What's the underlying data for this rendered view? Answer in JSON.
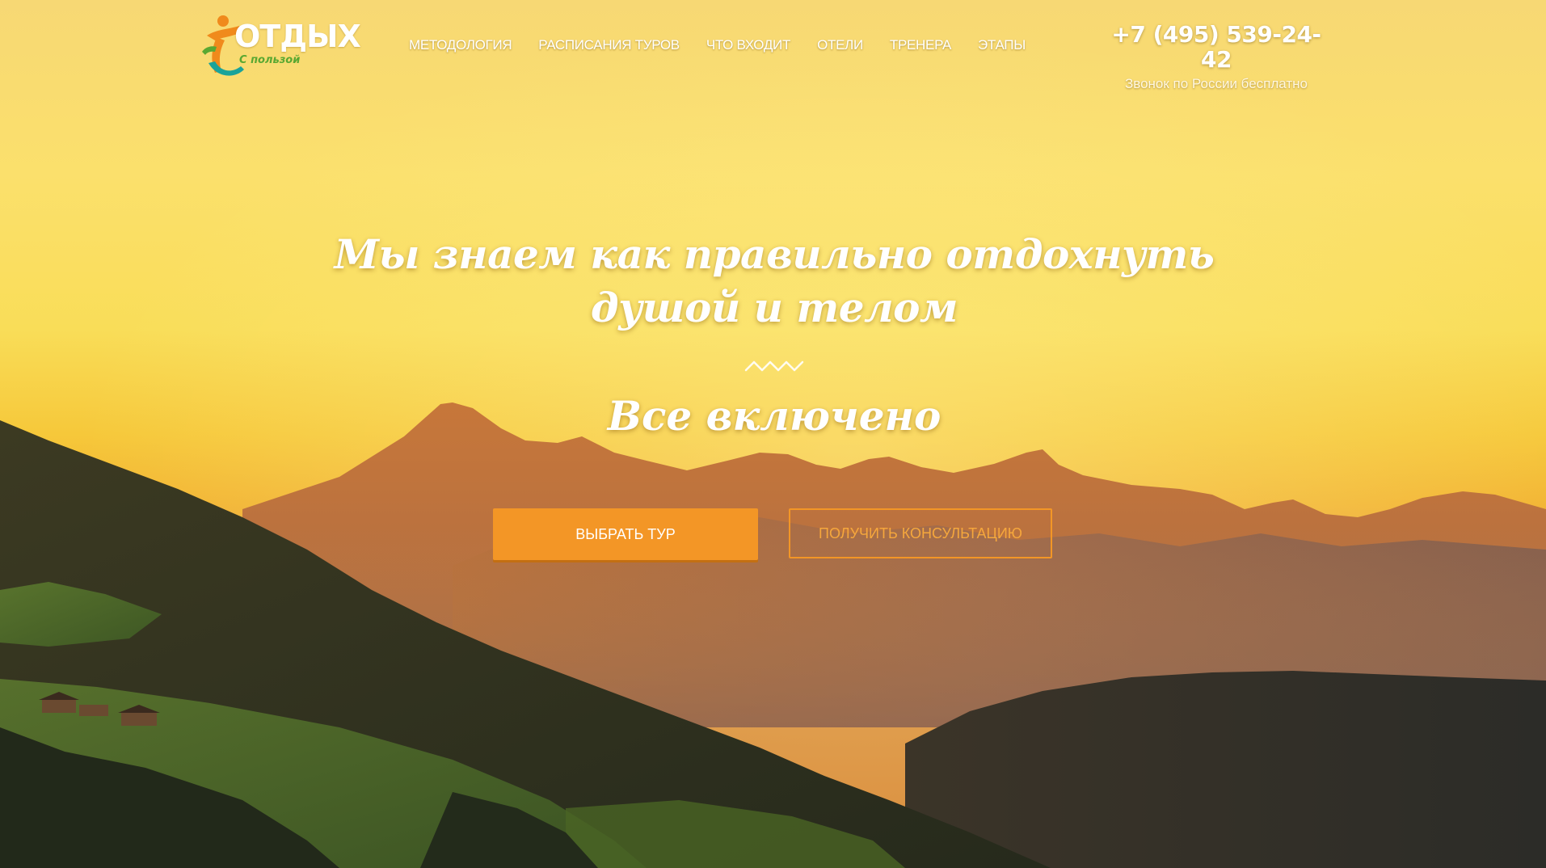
{
  "header": {
    "logo": {
      "word": "ОТДЫХ",
      "sub": "С пользой"
    },
    "nav": [
      {
        "label": "МЕТОДОЛОГИЯ"
      },
      {
        "label": "РАСПИСАНИЯ ТУРОВ"
      },
      {
        "label": "ЧТО ВХОДИТ"
      },
      {
        "label": "ОТЕЛИ"
      },
      {
        "label": "ТРЕНЕРА"
      },
      {
        "label": "ЭТАПЫ"
      }
    ],
    "phone": "+7 (495) 539-24-42",
    "phone_note": "Звонок по России бесплатно"
  },
  "hero": {
    "headline": "Мы знаем как правильно отдохнуть душой и телом",
    "subheadline": "Все включено",
    "primary_button": "ВЫБРАТЬ ТУР",
    "secondary_button": "ПОЛУЧИТЬ КОНСУЛЬТАЦИЮ"
  },
  "colors": {
    "accent": "#f39626",
    "logo_orange": "#f08a1c",
    "logo_green": "#5aa832",
    "logo_teal": "#1aa39a"
  }
}
